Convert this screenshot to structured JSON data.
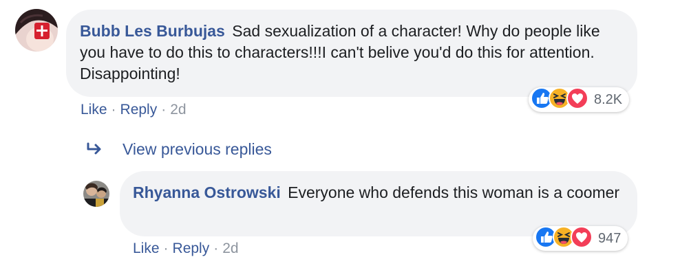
{
  "comment": {
    "author": "Bubb Les Burbujas",
    "text": "Sad sexualization of a character! Why do people like you have to do this to characters!!!I can't belive you'd do this for attention. Disappointing!",
    "actions": {
      "like": "Like",
      "reply": "Reply",
      "separator": "·",
      "time": "2d"
    },
    "reactions": {
      "icons": [
        "like-reaction",
        "haha-reaction",
        "love-reaction"
      ],
      "count": "8.2K"
    }
  },
  "view_previous_replies": {
    "label": "View previous replies",
    "icon": "reply-arrow-icon"
  },
  "reply": {
    "author": "Rhyanna Ostrowski",
    "text": "Everyone who defends this woman is a coomer",
    "actions": {
      "like": "Like",
      "reply": "Reply",
      "separator": "·",
      "time": "2d"
    },
    "reactions": {
      "icons": [
        "like-reaction",
        "haha-reaction",
        "love-reaction"
      ],
      "count": "947"
    }
  },
  "colors": {
    "link": "#385898",
    "bubble_bg": "#f2f3f5",
    "meta_text": "#8d949e",
    "like_blue": "#1877f2",
    "haha_yellow": "#f7b125",
    "love_red": "#f33e58"
  }
}
